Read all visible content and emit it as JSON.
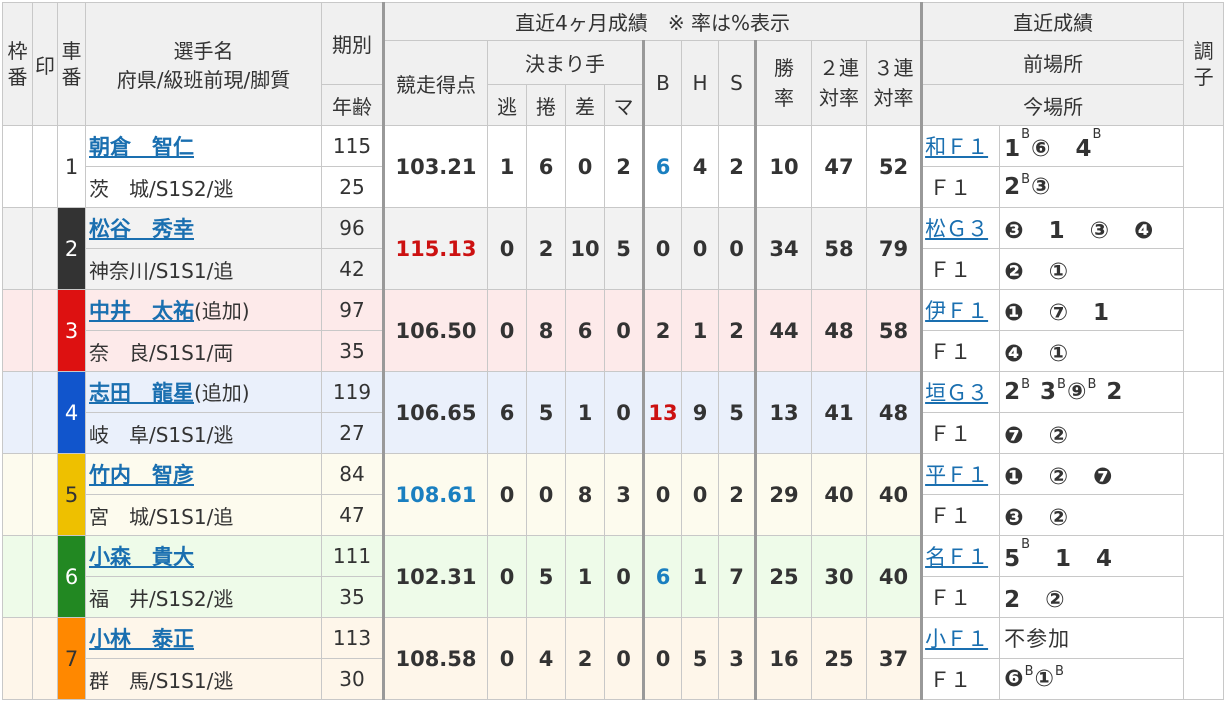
{
  "header": {
    "waku": "枠番",
    "mark": "印",
    "car": "車番",
    "player_name": "選手名",
    "player_sub": "府県/級班前現/脚質",
    "term": "期別",
    "age": "年齢",
    "recent_4m": "直近4ヶ月成績　※ 率は%表示",
    "score": "競走得点",
    "kimarite": "決まり手",
    "nige": "逃",
    "makuri": "捲",
    "sashi": "差",
    "mark_k": "マ",
    "b": "B",
    "h": "H",
    "s": "S",
    "win1": "勝",
    "win2": "率",
    "ren2a": "２連",
    "ren2b": "対率",
    "ren3a": "３連",
    "ren3b": "対率",
    "recent": "直近成績",
    "prev_venue": "前場所",
    "cur_venue": "今場所",
    "cond": "調子"
  },
  "riders": [
    {
      "car": "1",
      "name": "朝倉　智仁",
      "note": "",
      "sub": "茨　城/S1S2/逃",
      "term": "115",
      "age": "25",
      "score": "103.21",
      "score_color": "",
      "nige": "1",
      "makuri": "6",
      "sashi": "0",
      "mark": "2",
      "b": "6",
      "b_color": "#1a7fc0",
      "h": "4",
      "s": "2",
      "win": "10",
      "ren2": "47",
      "ren3": "52",
      "prev_venue": "和Ｆ１",
      "prev_result": "1<sup>B</sup>⑥　4<sup>B</sup>",
      "cur_venue": "Ｆ１",
      "cur_result": "2<sup>B</sup>③"
    },
    {
      "car": "2",
      "name": "松谷　秀幸",
      "note": "",
      "sub": "神奈川/S1S1/追",
      "term": "96",
      "age": "42",
      "score": "115.13",
      "score_color": "#cc1111",
      "nige": "0",
      "makuri": "2",
      "sashi": "10",
      "mark": "5",
      "b": "0",
      "b_color": "",
      "h": "0",
      "s": "0",
      "win": "34",
      "ren2": "58",
      "ren3": "79",
      "prev_venue": "松Ｇ３",
      "prev_result": "❸　1　③　❹",
      "cur_venue": "Ｆ１",
      "cur_result": "❷　①"
    },
    {
      "car": "3",
      "name": "中井　太祐",
      "note": "(追加)",
      "sub": "奈　良/S1S1/両",
      "term": "97",
      "age": "35",
      "score": "106.50",
      "score_color": "",
      "nige": "0",
      "makuri": "8",
      "sashi": "6",
      "mark": "0",
      "b": "2",
      "b_color": "",
      "h": "1",
      "s": "2",
      "win": "44",
      "ren2": "48",
      "ren3": "58",
      "prev_venue": "伊Ｆ１",
      "prev_result": "❶　⑦　1",
      "cur_venue": "Ｆ１",
      "cur_result": "❹　①"
    },
    {
      "car": "4",
      "name": "志田　龍星",
      "note": "(追加)",
      "sub": "岐　阜/S1S1/逃",
      "term": "119",
      "age": "27",
      "score": "106.65",
      "score_color": "",
      "nige": "6",
      "makuri": "5",
      "sashi": "1",
      "mark": "0",
      "b": "13",
      "b_color": "#cc1111",
      "h": "9",
      "s": "5",
      "win": "13",
      "ren2": "41",
      "ren3": "48",
      "prev_venue": "垣Ｇ３",
      "prev_result": "2<sup>B</sup> 3<sup>B</sup>⑨<sup>B</sup> 2",
      "cur_venue": "Ｆ１",
      "cur_result": "❼　②"
    },
    {
      "car": "5",
      "name": "竹内　智彦",
      "note": "",
      "sub": "宮　城/S1S1/追",
      "term": "84",
      "age": "47",
      "score": "108.61",
      "score_color": "#1a7fc0",
      "nige": "0",
      "makuri": "0",
      "sashi": "8",
      "mark": "3",
      "b": "0",
      "b_color": "",
      "h": "0",
      "s": "2",
      "win": "29",
      "ren2": "40",
      "ren3": "40",
      "prev_venue": "平Ｆ１",
      "prev_result": "❶　②　❼",
      "cur_venue": "Ｆ１",
      "cur_result": "❸　②"
    },
    {
      "car": "6",
      "name": "小森　貴大",
      "note": "",
      "sub": "福　井/S1S2/逃",
      "term": "111",
      "age": "35",
      "score": "102.31",
      "score_color": "",
      "nige": "0",
      "makuri": "5",
      "sashi": "1",
      "mark": "0",
      "b": "6",
      "b_color": "#1a7fc0",
      "h": "1",
      "s": "7",
      "win": "25",
      "ren2": "30",
      "ren3": "40",
      "prev_venue": "名Ｆ１",
      "prev_result": "5<sup>B</sup>　1　4",
      "cur_venue": "Ｆ１",
      "cur_result": "2　②"
    },
    {
      "car": "7",
      "name": "小林　泰正",
      "note": "",
      "sub": "群　馬/S1S1/逃",
      "term": "113",
      "age": "30",
      "score": "108.58",
      "score_color": "",
      "nige": "0",
      "makuri": "4",
      "sashi": "2",
      "mark": "0",
      "b": "0",
      "b_color": "",
      "h": "5",
      "s": "3",
      "win": "16",
      "ren2": "25",
      "ren3": "37",
      "prev_venue": "小Ｆ１",
      "prev_result": "不参加",
      "cur_venue": "Ｆ１",
      "cur_result": "❻<sup>B</sup>①<sup>B</sup>"
    }
  ]
}
